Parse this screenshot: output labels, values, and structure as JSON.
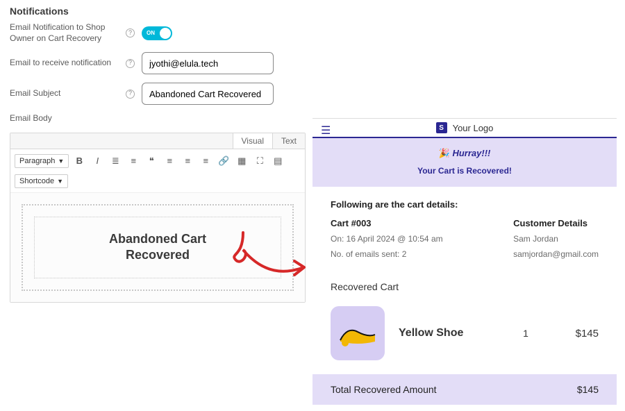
{
  "section_title": "Notifications",
  "fields": {
    "toggle_label": "Email Notification to Shop Owner on Cart Recovery",
    "toggle_state": "ON",
    "email_label": "Email to receive notification",
    "email_value": "jyothi@elula.tech",
    "subject_label": "Email Subject",
    "subject_value": "Abandoned Cart Recovered",
    "body_label": "Email Body"
  },
  "editor": {
    "tabs": {
      "visual": "Visual",
      "text": "Text"
    },
    "para_select": "Paragraph",
    "shortcode_select": "Shortcode",
    "preview_line1": "Abandoned Cart",
    "preview_line2": "Recovered"
  },
  "email": {
    "brand": "Your Logo",
    "hurray": "Hurray!!!",
    "recovered_msg": "Your Cart is Recovered!",
    "following": "Following are the cart details:",
    "cart_id_label": "Cart #003",
    "order_on": "On: 16 April 2024 @ 10:54 am",
    "emails_sent": "No. of emails sent: 2",
    "customer_header": "Customer Details",
    "customer_name": "Sam Jordan",
    "customer_email": "samjordan@gmail.com",
    "recovered_cart_header": "Recovered Cart",
    "item": {
      "name": "Yellow Shoe",
      "qty": "1",
      "price": "$145"
    },
    "total_label": "Total Recovered Amount",
    "total_value": "$145"
  }
}
